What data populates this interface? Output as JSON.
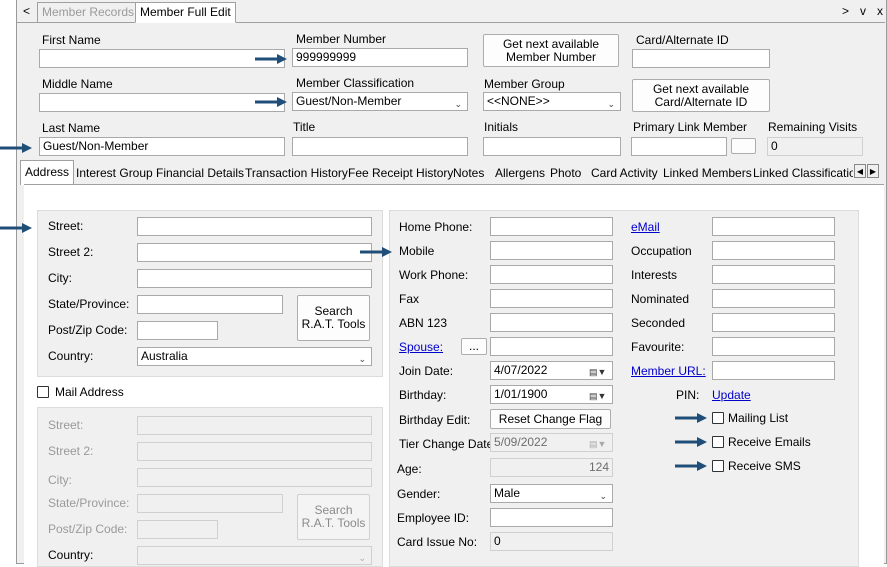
{
  "window": {
    "nav_back": "<",
    "tabs": [
      {
        "label": "Member Records",
        "active": false
      },
      {
        "label": "Member Full Edit",
        "active": true
      }
    ],
    "controls": {
      "more": ">",
      "down": "v",
      "close": "x"
    }
  },
  "header": {
    "first_name": {
      "label": "First Name",
      "value": ""
    },
    "member_number": {
      "label": "Member Number",
      "value": "999999999"
    },
    "next_member_btn": "Get next available Member Number",
    "card_alt_id": {
      "label": "Card/Alternate ID",
      "value": ""
    },
    "middle_name": {
      "label": "Middle Name",
      "value": ""
    },
    "member_classification": {
      "label": "Member Classification",
      "value": "Guest/Non-Member"
    },
    "member_group": {
      "label": "Member Group",
      "value": "<<NONE>>"
    },
    "next_card_btn": "Get next available Card/Alternate ID",
    "last_name": {
      "label": "Last Name",
      "value": "Guest/Non-Member"
    },
    "title": {
      "label": "Title",
      "value": ""
    },
    "initials": {
      "label": "Initials",
      "value": ""
    },
    "primary_link": {
      "label": "Primary Link Member",
      "value": ""
    },
    "remaining_visits": {
      "label": "Remaining Visits",
      "value": "0"
    }
  },
  "tabs": [
    "Address",
    "Interest Group",
    "Financial Details",
    "Transaction History",
    "Fee Receipt History",
    "Notes",
    "Allergens",
    "Photo",
    "Card Activity",
    "Linked Members",
    "Linked Classifications"
  ],
  "address": {
    "street": "Street:",
    "street2": "Street 2:",
    "city": "City:",
    "state": "State/Province:",
    "postcode": "Post/Zip Code:",
    "country": "Country:",
    "country_value": "Australia",
    "search_btn": "Search R.A.T. Tools",
    "mail_address": "Mail Address"
  },
  "mail": {
    "street": "Street:",
    "street2": "Street 2:",
    "city": "City:",
    "state": "State/Province:",
    "postcode": "Post/Zip Code:",
    "country": "Country:",
    "search_btn": "Search R.A.T. Tools"
  },
  "contact": {
    "home_phone": "Home Phone:",
    "mobile": "Mobile",
    "work_phone": "Work Phone:",
    "fax": "Fax",
    "abn": "ABN 123",
    "spouse": "Spouse:",
    "spouse_btn": "...",
    "join_date": "Join Date:",
    "join_date_value": "4/07/2022",
    "birthday": "Birthday:",
    "birthday_value": "1/01/1900",
    "birthday_edit": "Birthday Edit:",
    "reset_btn": "Reset Change Flag",
    "tier_change": "Tier Change Date:",
    "tier_change_value": "5/09/2022",
    "age": "Age:",
    "age_value": "124",
    "gender": "Gender:",
    "gender_value": "Male",
    "employee_id": "Employee ID:",
    "card_issue": "Card Issue No:",
    "card_issue_value": "0"
  },
  "extra": {
    "email": "eMail",
    "occupation": "Occupation",
    "interests": "Interests",
    "nominated": "Nominated",
    "seconded": "Seconded",
    "favourite": "Favourite:",
    "member_url": "Member URL:",
    "pin": "PIN:",
    "update": "Update",
    "mailing_list": "Mailing List",
    "receive_emails": "Receive Emails",
    "receive_sms": "Receive SMS"
  },
  "accent": "#1f4e79"
}
